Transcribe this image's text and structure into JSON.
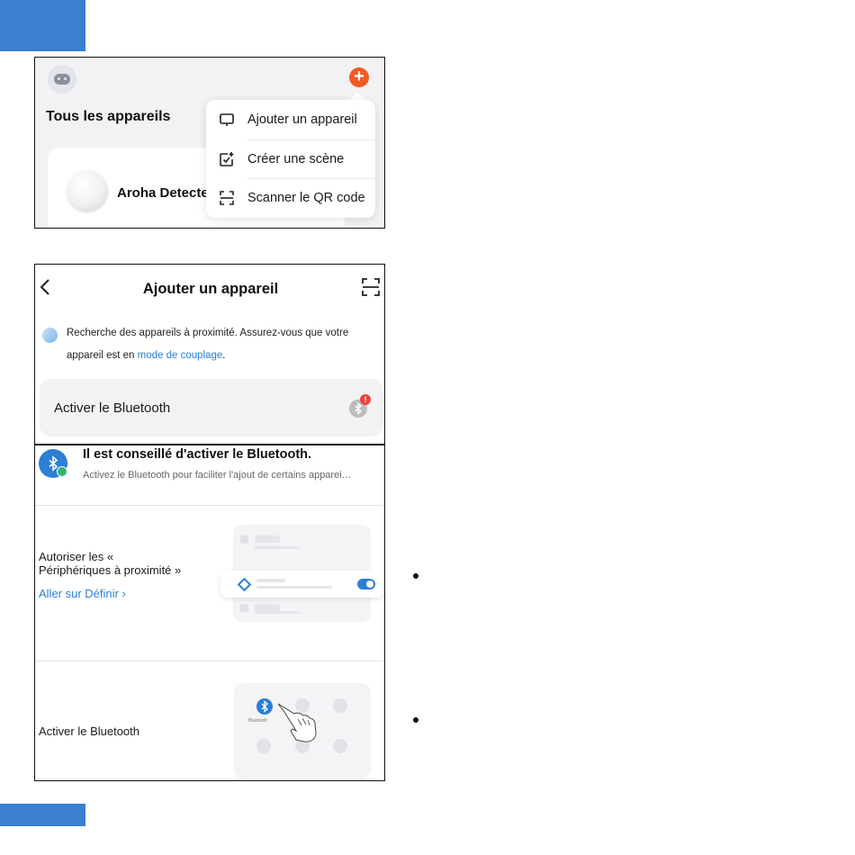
{
  "colors": {
    "accent_blue": "#2b7fd4",
    "deco_blue": "#3a7fd0",
    "add_button_orange": "#f25a22",
    "alert_red": "#e9463b",
    "success_green": "#2fb56a"
  },
  "screen1": {
    "section_title": "Tous les appareils",
    "device_name": "Aroha Detecte",
    "add_button_symbol": "+",
    "menu": [
      {
        "label": "Ajouter un appareil",
        "icon": "add-device-icon"
      },
      {
        "label": "Créer une scène",
        "icon": "create-scene-icon"
      },
      {
        "label": "Scanner le QR code",
        "icon": "scan-qr-icon"
      }
    ]
  },
  "screen2": {
    "title": "Ajouter un appareil",
    "search_text": "Recherche des appareils à proximité. Assurez-vous que votre appareil est en ",
    "search_link": "mode de couplage",
    "search_end": ".",
    "bluetooth_row_label": "Activer le Bluetooth",
    "bluetooth_alert_symbol": "!",
    "tip_title": "Il est conseillé d'activer le Bluetooth.",
    "tip_subtitle": "Activez le Bluetooth pour faciliter l'ajout de certains apparei…",
    "step1_text_line1": "Autoriser les «",
    "step1_text_line2": "Périphériques à proximité »",
    "step1_link": "Aller sur Définir",
    "step1_link_chevron": "›",
    "step2_text": "Activer le Bluetooth",
    "illus2_caption": "Bluetooth"
  }
}
